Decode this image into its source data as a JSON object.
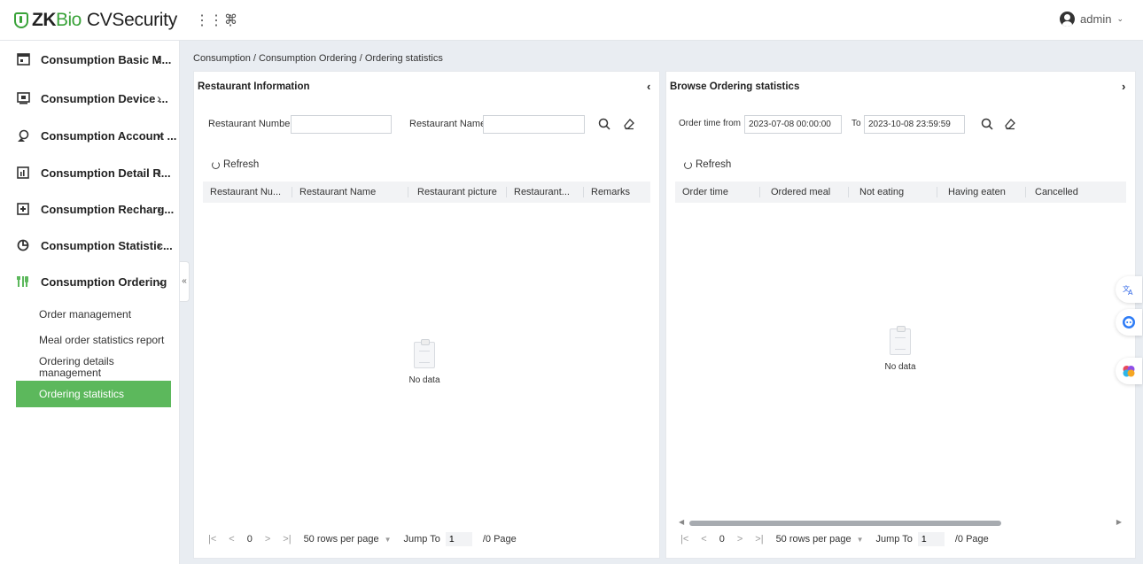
{
  "app": {
    "logo_zk": "ZK",
    "logo_bio": "Bio",
    "logo_cv": "CVSecurity",
    "user": "admin"
  },
  "colors": {
    "accent": "#5cb85c",
    "brand_green": "#3aa33a"
  },
  "sidebar": {
    "items": [
      {
        "label": "Consumption Basic M...",
        "icon": "basic-management-icon"
      },
      {
        "label": "Consumption Device ...",
        "icon": "device-icon"
      },
      {
        "label": "Consumption Account ...",
        "icon": "account-icon"
      },
      {
        "label": "Consumption Detail R...",
        "icon": "detail-report-icon"
      },
      {
        "label": "Consumption Recharg...",
        "icon": "recharge-icon"
      },
      {
        "label": "Consumption Statistic...",
        "icon": "statistics-icon"
      },
      {
        "label": "Consumption Ordering",
        "icon": "ordering-icon"
      }
    ],
    "sub_items": [
      {
        "label": "Order management"
      },
      {
        "label": "Meal order statistics report"
      },
      {
        "label": "Ordering details management"
      },
      {
        "label": "Ordering statistics"
      }
    ]
  },
  "breadcrumb": "Consumption / Consumption Ordering / Ordering statistics",
  "left_panel": {
    "title": "Restaurant Information",
    "field1_label": "Restaurant Number",
    "field1_value": "",
    "field2_label": "Restaurant Name",
    "field2_value": "",
    "refresh": "Refresh",
    "columns": [
      "Restaurant Nu...",
      "Restaurant Name",
      "Restaurant picture",
      "Restaurant...",
      "Remarks"
    ],
    "empty": "No data",
    "pager": {
      "count": "0",
      "rows_per_page": "50 rows per page",
      "jump_to": "Jump To",
      "page_value": "1",
      "total": "/0 Page"
    }
  },
  "right_panel": {
    "title": "Browse Ordering statistics",
    "from_label": "Order time from",
    "from_value": "2023-07-08 00:00:00",
    "to_label": "To",
    "to_value": "2023-10-08 23:59:59",
    "refresh": "Refresh",
    "columns": [
      "Order time",
      "Ordered meal",
      "Not eating",
      "Having eaten",
      "Cancelled"
    ],
    "empty": "No data",
    "pager": {
      "count": "0",
      "rows_per_page": "50 rows per page",
      "jump_to": "Jump To",
      "page_value": "1",
      "total": "/0 Page"
    }
  }
}
